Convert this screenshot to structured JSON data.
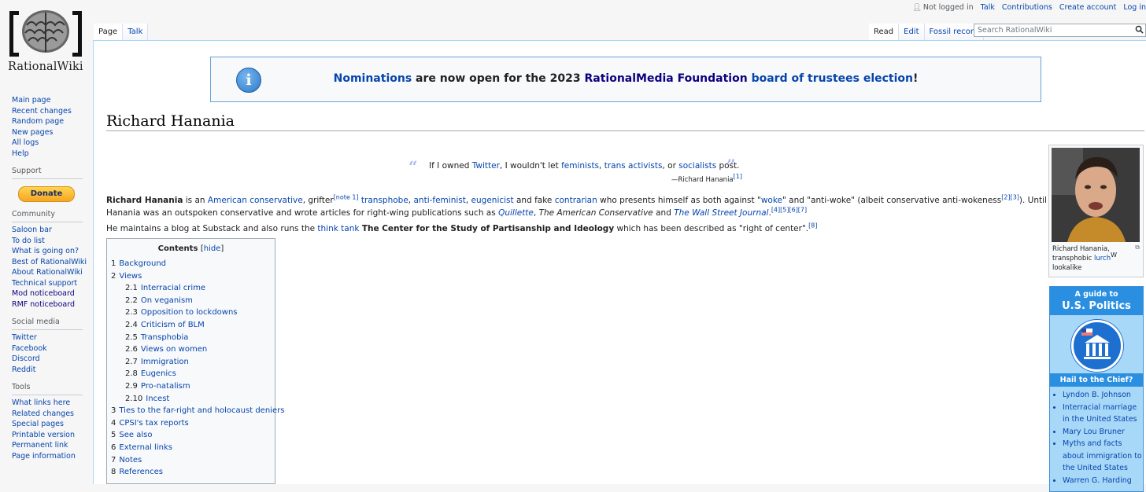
{
  "logo": {
    "wordmark": "RationalWiki"
  },
  "personal": {
    "not_logged_in": "Not logged in",
    "talk": "Talk",
    "contributions": "Contributions",
    "create_account": "Create account",
    "log_in": "Log in"
  },
  "tabs": {
    "page": "Page",
    "talk": "Talk",
    "read": "Read",
    "edit": "Edit",
    "history": "Fossil record"
  },
  "search": {
    "placeholder": "Search RationalWiki"
  },
  "sidebar": {
    "nav": [
      "Main page",
      "Recent changes",
      "Random page",
      "New pages",
      "All logs",
      "Help"
    ],
    "support_heading": "Support",
    "donate": "Donate",
    "community_heading": "Community",
    "community": [
      "Saloon bar",
      "To do list",
      "What is going on?",
      "Best of RationalWiki",
      "About RationalWiki",
      "Technical support",
      "Mod noticeboard",
      "RMF noticeboard"
    ],
    "social_heading": "Social media",
    "social": [
      "Twitter",
      "Facebook",
      "Discord",
      "Reddit"
    ],
    "tools_heading": "Tools",
    "tools": [
      "What links here",
      "Related changes",
      "Special pages",
      "Printable version",
      "Permanent link",
      "Page information"
    ]
  },
  "banner": {
    "icon": "i",
    "nominations": "Nominations",
    "mid": " are now open for the 2023 ",
    "foundation": "RationalMedia Foundation",
    "space": " ",
    "election": "board of trustees election",
    "end": "!"
  },
  "article": {
    "title": "Richard Hanania",
    "quote": {
      "open": "“",
      "close": "”",
      "p1": "If I owned ",
      "twitter": "Twitter",
      "p2": ", I wouldn't let ",
      "feminists": "feminists",
      "c1": ", ",
      "trans": "trans activists",
      "c2": ", or ",
      "socialists": "socialists",
      "p3": " post.",
      "attr": "—Richard Hanania",
      "attr_ref": "[1]"
    },
    "para1a": {
      "name": "Richard Hanania",
      "t1": " is an ",
      "l1": "American conservative",
      "t2": ", grifter",
      "n1": "[note 1]",
      "t3": " ",
      "l2": "transphobe",
      "t4": ", ",
      "l3": "anti-feminist",
      "t5": ", ",
      "l4": "eugenicist",
      "t6": " and fake ",
      "l5": "contrarian",
      "t7": " who presents himself as both against \"",
      "l6": "woke",
      "t8": "\" and \"anti-woke\" (albeit conservative anti-wokeness",
      "r1": "[2][3]",
      "t9": "). Until recently,"
    },
    "para1b": {
      "t1": "Hanania was an outspoken conservative and wrote articles for right-wing publications such as ",
      "l1": "Quillette",
      "t2": ", ",
      "i1": "The American Conservative",
      "t3": " and ",
      "l2": "The Wall Street Journal",
      "t4": ".",
      "r1": "[4][5][6][7]"
    },
    "para2": {
      "t1": "He maintains a blog at Substack and also runs the ",
      "l1": "think tank",
      "t2": " ",
      "b1": "The Center for the Study of Partisanship and Ideology",
      "t3": " which has been described as \"right of center\".",
      "r1": "[8]"
    }
  },
  "toc": {
    "title": "Contents",
    "hide": "hide",
    "items": [
      {
        "num": "1",
        "label": "Background",
        "sub": false
      },
      {
        "num": "2",
        "label": "Views",
        "sub": false
      },
      {
        "num": "2.1",
        "label": "Interracial crime",
        "sub": true
      },
      {
        "num": "2.2",
        "label": "On veganism",
        "sub": true
      },
      {
        "num": "2.3",
        "label": "Opposition to lockdowns",
        "sub": true
      },
      {
        "num": "2.4",
        "label": "Criticism of BLM",
        "sub": true
      },
      {
        "num": "2.5",
        "label": "Transphobia",
        "sub": true
      },
      {
        "num": "2.6",
        "label": "Views on women",
        "sub": true
      },
      {
        "num": "2.7",
        "label": "Immigration",
        "sub": true
      },
      {
        "num": "2.8",
        "label": "Eugenics",
        "sub": true
      },
      {
        "num": "2.9",
        "label": "Pro-natalism",
        "sub": true
      },
      {
        "num": "2.10",
        "label": "Incest",
        "sub": true
      },
      {
        "num": "3",
        "label": "Ties to the far-right and holocaust deniers",
        "sub": false
      },
      {
        "num": "4",
        "label": "CPSI's tax reports",
        "sub": false
      },
      {
        "num": "5",
        "label": "See also",
        "sub": false
      },
      {
        "num": "6",
        "label": "External links",
        "sub": false
      },
      {
        "num": "7",
        "label": "Notes",
        "sub": false
      },
      {
        "num": "8",
        "label": "References",
        "sub": false
      }
    ]
  },
  "infobox": {
    "cap1": "Richard Hanania, transphobic ",
    "cap_link": "lurch",
    "cap_w": "W",
    "cap2": " lookalike"
  },
  "politics": {
    "h1": "A guide to",
    "h2": "U.S. Politics",
    "h3": "Hail to the Chief?",
    "items": [
      "Lyndon B. Johnson",
      "Interracial marriage in the United States",
      "Mary Lou Bruner",
      "Myths and facts about immigration to the United States",
      "Warren G. Harding"
    ]
  }
}
